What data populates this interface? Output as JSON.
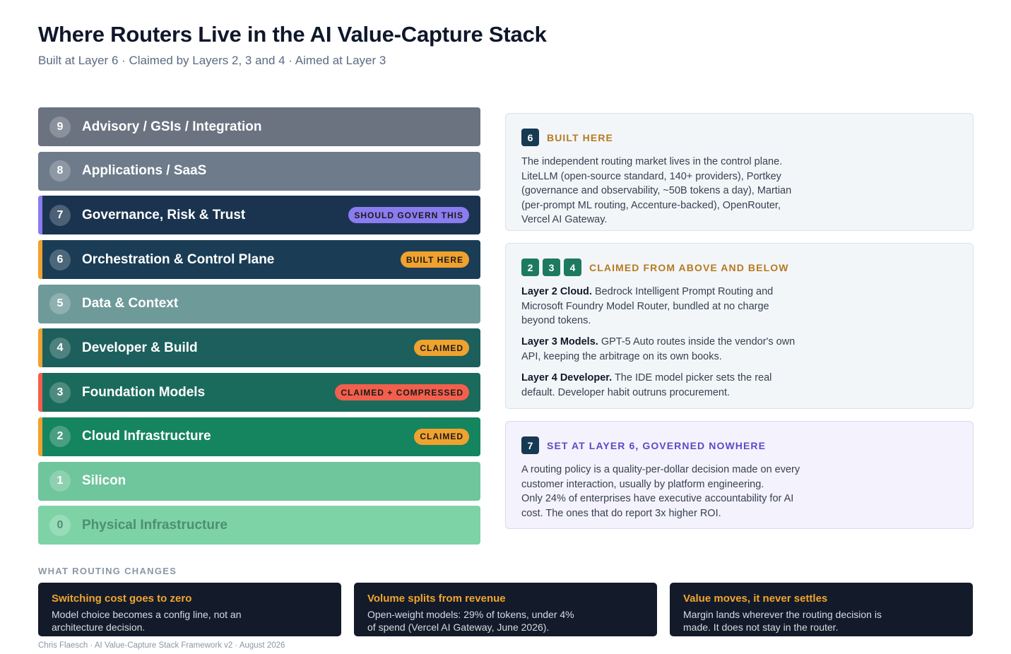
{
  "header": {
    "title": "Where Routers Live in the AI Value-Capture Stack",
    "subtitle": "Built at Layer 6 · Claimed by Layers 2, 3 and 4 · Aimed at Layer 3"
  },
  "layers": [
    {
      "num": "9",
      "name": "Advisory / GSIs / Integration",
      "bg": "#6b7280",
      "accent": "",
      "badge": "",
      "badge_color": ""
    },
    {
      "num": "8",
      "name": "Applications / SaaS",
      "bg": "#6e7b8b",
      "accent": "",
      "badge": "",
      "badge_color": ""
    },
    {
      "num": "7",
      "name": "Governance, Risk & Trust",
      "bg": "#1a3450",
      "accent": "#8b7cf0",
      "badge": "SHOULD GOVERN THIS",
      "badge_color": "#8b7cf0"
    },
    {
      "num": "6",
      "name": "Orchestration & Control Plane",
      "bg": "#1a3d55",
      "accent": "#f0a22e",
      "badge": "BUILT HERE",
      "badge_color": "#f0a22e"
    },
    {
      "num": "5",
      "name": "Data & Context",
      "bg": "#6f9a9a",
      "accent": "",
      "badge": "",
      "badge_color": ""
    },
    {
      "num": "4",
      "name": "Developer & Build",
      "bg": "#1d5f5c",
      "accent": "#f0a22e",
      "badge": "CLAIMED",
      "badge_color": "#f0a22e"
    },
    {
      "num": "3",
      "name": "Foundation Models",
      "bg": "#1b6b5c",
      "accent": "#f25f4c",
      "badge": "CLAIMED + COMPRESSED",
      "badge_color": "#f25f4c"
    },
    {
      "num": "2",
      "name": "Cloud Infrastructure",
      "bg": "#15855f",
      "accent": "#f0a22e",
      "badge": "CLAIMED",
      "badge_color": "#f0a22e"
    },
    {
      "num": "1",
      "name": "Silicon",
      "bg": "#6fc59c",
      "accent": "",
      "badge": "",
      "badge_color": ""
    },
    {
      "num": "0",
      "name": "Physical Infrastructure",
      "bg": "#7dd3a6",
      "accent": "",
      "badge": "",
      "badge_color": ""
    }
  ],
  "cards": {
    "built": {
      "chip": "6",
      "label": "BUILT HERE",
      "text": "The independent routing market lives in the control plane. LiteLLM (open-source standard, 140+ providers), Portkey (governance and observability, ~50B tokens a day), Martian (per-prompt ML routing, Accenture-backed), OpenRouter, Vercel AI Gateway."
    },
    "claimed": {
      "chips": [
        "2",
        "3",
        "4"
      ],
      "label": "CLAIMED FROM ABOVE AND BELOW",
      "items": [
        {
          "bold": "Layer 2 Cloud.",
          "text": " Bedrock Intelligent Prompt Routing and Microsoft Foundry Model Router, bundled at no charge beyond tokens."
        },
        {
          "bold": "Layer 3 Models.",
          "text": " GPT-5 Auto routes inside the vendor's own API, keeping the arbitrage on its own books."
        },
        {
          "bold": "Layer 4 Developer.",
          "text": " The IDE model picker sets the real default. Developer habit outruns procurement."
        }
      ]
    },
    "governed": {
      "chip": "7",
      "label": "SET AT LAYER 6, GOVERNED NOWHERE",
      "line1": "A routing policy is a quality-per-dollar decision made on every customer interaction, usually by platform engineering.",
      "line2": "Only 24% of enterprises have executive accountability for AI cost. The ones that do report 3x higher ROI."
    }
  },
  "changes": {
    "label": "WHAT ROUTING CHANGES",
    "items": [
      {
        "title": "Switching cost goes to zero",
        "text": "Model choice becomes a config line, not an architecture decision."
      },
      {
        "title": "Volume splits from revenue",
        "text": "Open-weight models: 29% of tokens, under 4% of spend (Vercel AI Gateway, June 2026)."
      },
      {
        "title": "Value moves, it never settles",
        "text": "Margin lands wherever the routing decision is made. It does not stay in the router."
      }
    ]
  },
  "footer": "Chris Flaesch · AI Value-Capture Stack Framework v2 · August 2026",
  "colors": {
    "chip_dark": "#163a52",
    "chip_green": "#1d7a5f",
    "amber_label": "#b7791f",
    "purple_label": "#5b4bc4"
  }
}
